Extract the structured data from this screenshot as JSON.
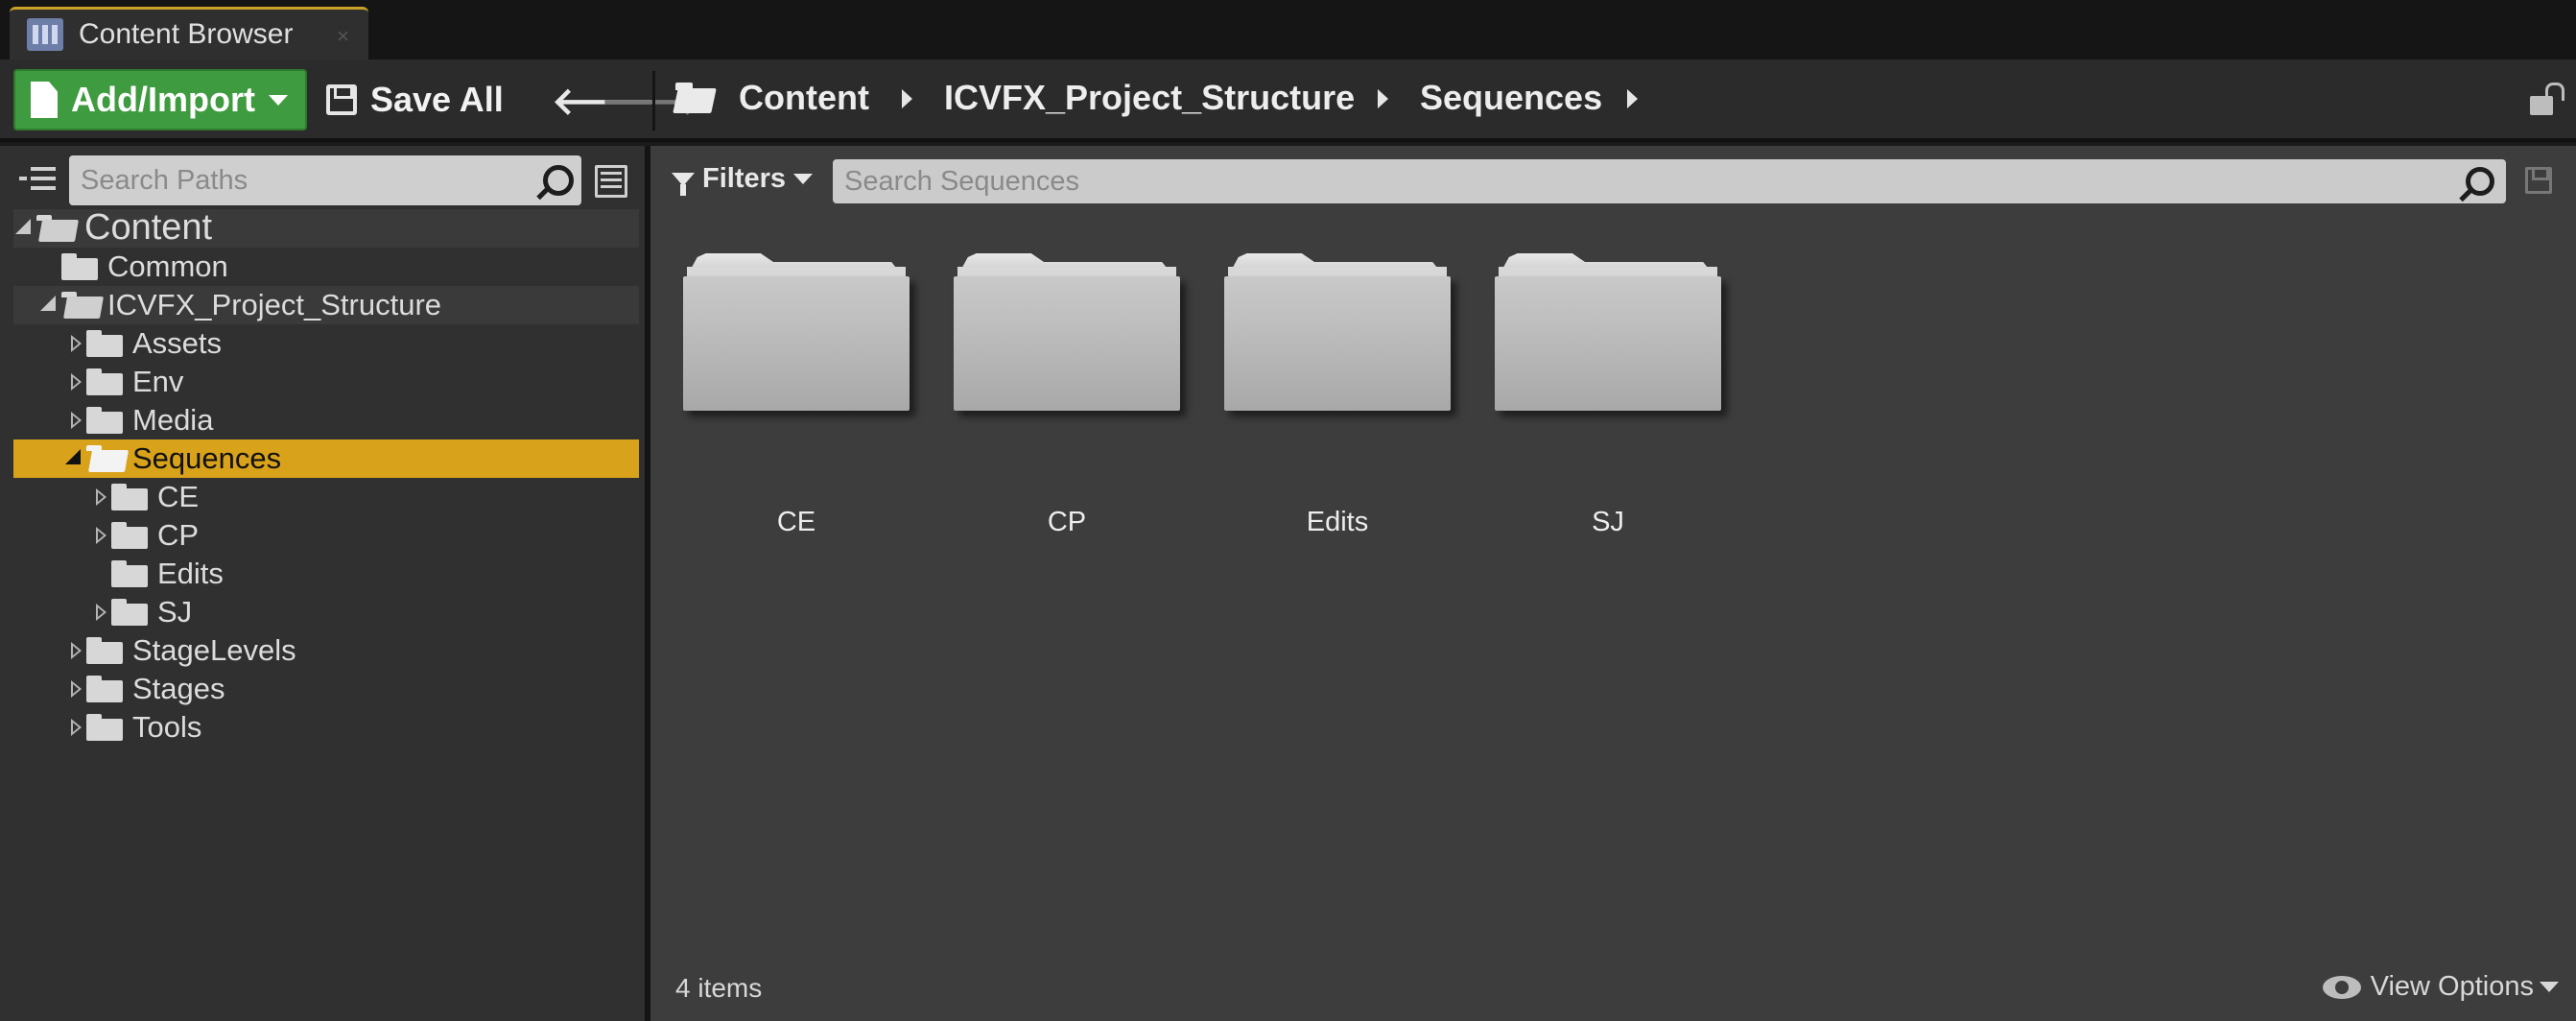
{
  "tab": {
    "title": "Content Browser",
    "close": "×"
  },
  "toolbar": {
    "add_label": "Add/Import",
    "save_all_label": "Save All",
    "nav_back": "🡐",
    "nav_forward": "🡒",
    "breadcrumbs": [
      "Content",
      "ICVFX_Project_Structure",
      "Sequences"
    ]
  },
  "sources": {
    "search_placeholder": "Search Paths",
    "tree": [
      {
        "label": "Content",
        "depth": 0,
        "expander": "expanded",
        "folder": "open",
        "state": "shaded"
      },
      {
        "label": "Common",
        "depth": 1,
        "expander": "none",
        "folder": "closed",
        "state": "normal"
      },
      {
        "label": "ICVFX_Project_Structure",
        "depth": 1,
        "expander": "expanded",
        "folder": "open",
        "state": "shaded"
      },
      {
        "label": "Assets",
        "depth": 2,
        "expander": "collapsed",
        "folder": "closed",
        "state": "normal"
      },
      {
        "label": "Env",
        "depth": 2,
        "expander": "collapsed",
        "folder": "closed",
        "state": "normal"
      },
      {
        "label": "Media",
        "depth": 2,
        "expander": "collapsed",
        "folder": "closed",
        "state": "normal"
      },
      {
        "label": "Sequences",
        "depth": 2,
        "expander": "expanded",
        "folder": "open",
        "state": "selected"
      },
      {
        "label": "CE",
        "depth": 3,
        "expander": "collapsed",
        "folder": "closed",
        "state": "normal"
      },
      {
        "label": "CP",
        "depth": 3,
        "expander": "collapsed",
        "folder": "closed",
        "state": "normal"
      },
      {
        "label": "Edits",
        "depth": 3,
        "expander": "none",
        "folder": "closed",
        "state": "normal"
      },
      {
        "label": "SJ",
        "depth": 3,
        "expander": "collapsed",
        "folder": "closed",
        "state": "normal"
      },
      {
        "label": "StageLevels",
        "depth": 2,
        "expander": "collapsed",
        "folder": "closed",
        "state": "normal"
      },
      {
        "label": "Stages",
        "depth": 2,
        "expander": "collapsed",
        "folder": "closed",
        "state": "normal"
      },
      {
        "label": "Tools",
        "depth": 2,
        "expander": "collapsed",
        "folder": "closed",
        "state": "normal"
      }
    ]
  },
  "assets": {
    "filters_label": "Filters",
    "search_placeholder": "Search Sequences",
    "items": [
      {
        "label": "CE"
      },
      {
        "label": "CP"
      },
      {
        "label": "Edits"
      },
      {
        "label": "SJ"
      }
    ],
    "count_text": "4 items",
    "view_options_label": "View Options"
  },
  "colors": {
    "accent_selection": "#d9a21b",
    "add_button": "#3f9b3f",
    "tab_highlight": "#c9a227"
  },
  "icons": [
    "content-browser-icon",
    "document-icon",
    "save-icon",
    "folder-open-icon",
    "lock-icon",
    "tree-view-icon",
    "search-icon",
    "list-view-icon",
    "filter-icon",
    "folder-icon",
    "eye-icon"
  ]
}
